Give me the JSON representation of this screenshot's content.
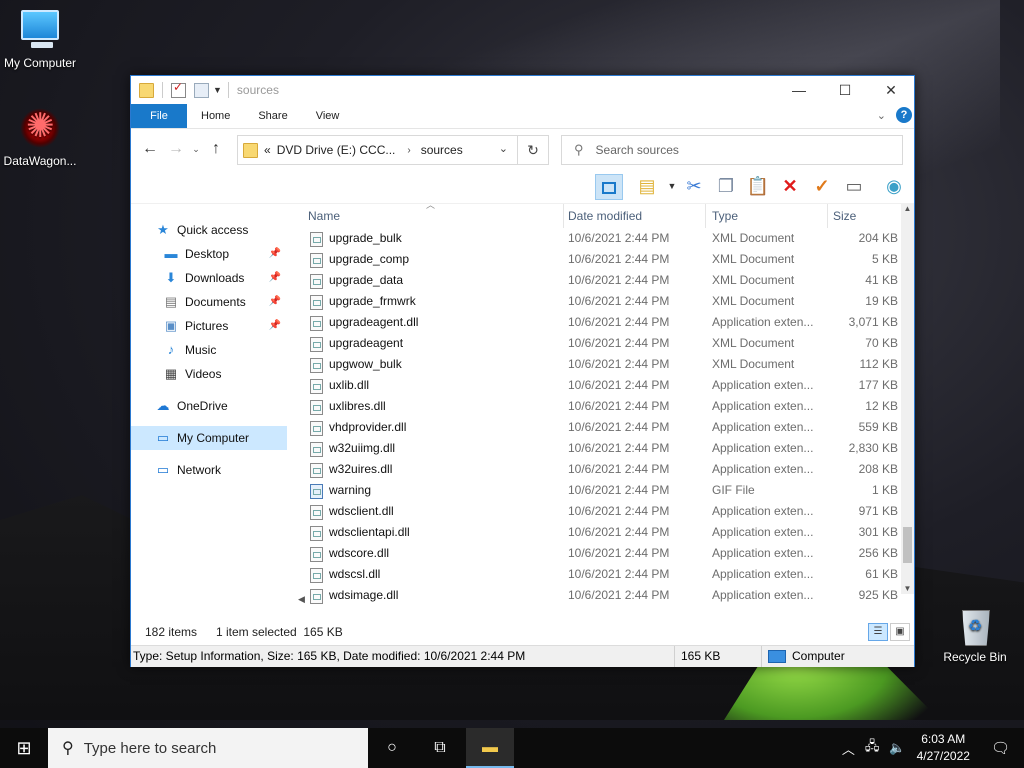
{
  "desktop": {
    "icons": [
      {
        "label": "My Computer"
      },
      {
        "label": "DataWagon..."
      },
      {
        "label": "Recycle Bin"
      }
    ]
  },
  "window": {
    "title": "sources",
    "ribbon_tabs": [
      "File",
      "Home",
      "Share",
      "View"
    ],
    "address": {
      "prefix": "«",
      "segments": [
        "DVD Drive (E:) CCC...",
        "sources"
      ]
    },
    "search_placeholder": "Search sources",
    "nav": {
      "items": [
        {
          "label": "Quick access",
          "icon": "star-icon"
        },
        {
          "label": "Desktop",
          "icon": "desktop-folder-icon",
          "pinned": true
        },
        {
          "label": "Downloads",
          "icon": "download-arrow-icon",
          "pinned": true
        },
        {
          "label": "Documents",
          "icon": "document-icon",
          "pinned": true
        },
        {
          "label": "Pictures",
          "icon": "picture-icon",
          "pinned": true
        },
        {
          "label": "Music",
          "icon": "music-note-icon"
        },
        {
          "label": "Videos",
          "icon": "film-icon"
        },
        {
          "label": "OneDrive",
          "icon": "cloud-icon"
        },
        {
          "label": "My Computer",
          "icon": "computer-icon",
          "selected": true
        },
        {
          "label": "Network",
          "icon": "network-icon"
        }
      ]
    },
    "columns": {
      "name": "Name",
      "date": "Date modified",
      "type": "Type",
      "size": "Size"
    },
    "files": [
      {
        "name": "upgrade_bulk",
        "date": "10/6/2021 2:44 PM",
        "type": "XML Document",
        "size": "204 KB"
      },
      {
        "name": "upgrade_comp",
        "date": "10/6/2021 2:44 PM",
        "type": "XML Document",
        "size": "5 KB"
      },
      {
        "name": "upgrade_data",
        "date": "10/6/2021 2:44 PM",
        "type": "XML Document",
        "size": "41 KB"
      },
      {
        "name": "upgrade_frmwrk",
        "date": "10/6/2021 2:44 PM",
        "type": "XML Document",
        "size": "19 KB"
      },
      {
        "name": "upgradeagent.dll",
        "date": "10/6/2021 2:44 PM",
        "type": "Application exten...",
        "size": "3,071 KB"
      },
      {
        "name": "upgradeagent",
        "date": "10/6/2021 2:44 PM",
        "type": "XML Document",
        "size": "70 KB"
      },
      {
        "name": "upgwow_bulk",
        "date": "10/6/2021 2:44 PM",
        "type": "XML Document",
        "size": "112 KB"
      },
      {
        "name": "uxlib.dll",
        "date": "10/6/2021 2:44 PM",
        "type": "Application exten...",
        "size": "177 KB"
      },
      {
        "name": "uxlibres.dll",
        "date": "10/6/2021 2:44 PM",
        "type": "Application exten...",
        "size": "12 KB"
      },
      {
        "name": "vhdprovider.dll",
        "date": "10/6/2021 2:44 PM",
        "type": "Application exten...",
        "size": "559 KB"
      },
      {
        "name": "w32uiimg.dll",
        "date": "10/6/2021 2:44 PM",
        "type": "Application exten...",
        "size": "2,830 KB"
      },
      {
        "name": "w32uires.dll",
        "date": "10/6/2021 2:44 PM",
        "type": "Application exten...",
        "size": "208 KB"
      },
      {
        "name": "warning",
        "date": "10/6/2021 2:44 PM",
        "type": "GIF File",
        "size": "1 KB"
      },
      {
        "name": "wdsclient.dll",
        "date": "10/6/2021 2:44 PM",
        "type": "Application exten...",
        "size": "971 KB"
      },
      {
        "name": "wdsclientapi.dll",
        "date": "10/6/2021 2:44 PM",
        "type": "Application exten...",
        "size": "301 KB"
      },
      {
        "name": "wdscore.dll",
        "date": "10/6/2021 2:44 PM",
        "type": "Application exten...",
        "size": "256 KB"
      },
      {
        "name": "wdscsl.dll",
        "date": "10/6/2021 2:44 PM",
        "type": "Application exten...",
        "size": "61 KB"
      },
      {
        "name": "wdsimage.dll",
        "date": "10/6/2021 2:44 PM",
        "type": "Application exten...",
        "size": "925 KB"
      }
    ],
    "status": {
      "count": "182 items",
      "selection": "1 item selected  165 KB"
    },
    "infobar": {
      "details": "Type: Setup Information, Size: 165 KB, Date modified: 10/6/2021 2:44 PM",
      "size": "165 KB",
      "location": "Computer"
    }
  },
  "taskbar": {
    "search_placeholder": "Type here to search",
    "time": "6:03 AM",
    "date": "4/27/2022"
  },
  "colors": {
    "accent": "#1979ca",
    "selection": "#cce8ff"
  }
}
